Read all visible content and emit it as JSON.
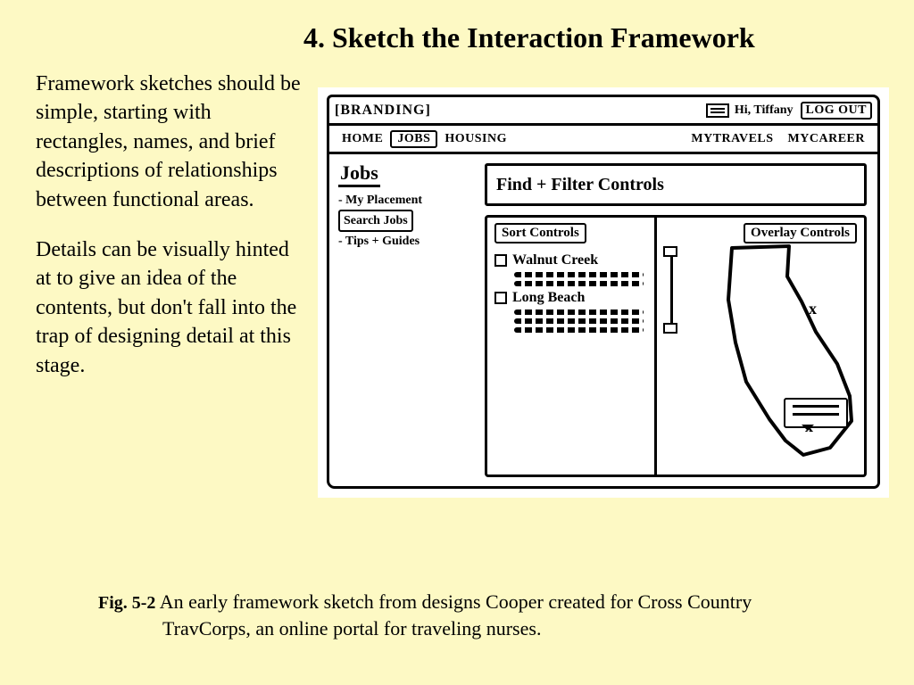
{
  "title": "4.  Sketch the Interaction Framework",
  "paragraphs": {
    "p1": "Framework sketches should be simple, starting with rectangles, names, and brief descriptions of relationships between functional areas.",
    "p2": "Details can be visually hinted at to give an idea of the contents, but don't fall into the trap of designing detail at this stage."
  },
  "caption": {
    "label": "Fig. 5-2",
    "text1": " An early framework sketch from designs Cooper created for Cross Country",
    "text2": "TravCorps, an online portal for traveling nurses."
  },
  "sketch": {
    "branding": "[BRANDING]",
    "greeting": "Hi, Tiffany",
    "logout": "Log Out",
    "nav": {
      "home": "Home",
      "jobs": "Jobs",
      "housing": "Housing",
      "travels": "MyTravels",
      "career": "MyCareer"
    },
    "left": {
      "heading": "Jobs",
      "item1": "- My Placement",
      "item2": "Search Jobs",
      "item3": "- Tips + Guides"
    },
    "findbar": "Find + Filter Controls",
    "sortHead": "Sort Controls",
    "overlayHead": "Overlay Controls",
    "result1": "Walnut Creek",
    "result2": "Long Beach"
  }
}
